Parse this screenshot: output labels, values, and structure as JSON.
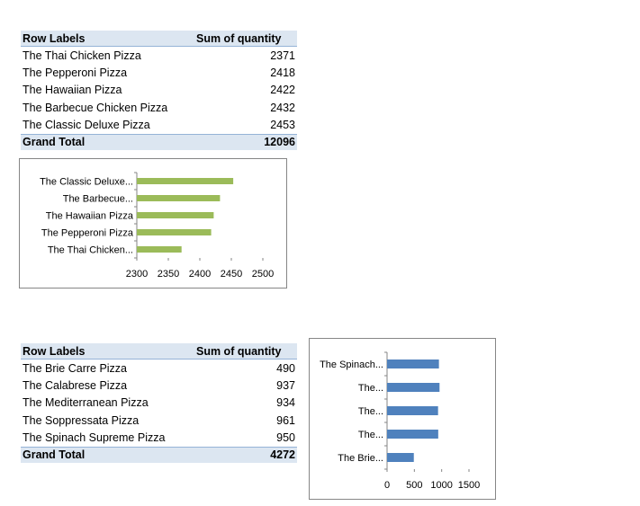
{
  "pivot1": {
    "header": {
      "row_labels": "Row Labels",
      "sum_label": "Sum of quantity"
    },
    "rows": [
      {
        "label": "The Thai Chicken Pizza",
        "value": "2371"
      },
      {
        "label": "The Pepperoni Pizza",
        "value": "2418"
      },
      {
        "label": "The Hawaiian Pizza",
        "value": "2422"
      },
      {
        "label": "The Barbecue Chicken Pizza",
        "value": "2432"
      },
      {
        "label": "The Classic Deluxe Pizza",
        "value": "2453"
      }
    ],
    "total": {
      "label": "Grand Total",
      "value": "12096"
    }
  },
  "pivot2": {
    "header": {
      "row_labels": "Row Labels",
      "sum_label": "Sum of quantity"
    },
    "rows": [
      {
        "label": "The Brie Carre Pizza",
        "value": "490"
      },
      {
        "label": "The Calabrese Pizza",
        "value": "937"
      },
      {
        "label": "The Mediterranean Pizza",
        "value": "934"
      },
      {
        "label": "The Soppressata Pizza",
        "value": "961"
      },
      {
        "label": "The Spinach Supreme Pizza",
        "value": "950"
      }
    ],
    "total": {
      "label": "Grand Total",
      "value": "4272"
    }
  },
  "chart_data": [
    {
      "type": "bar",
      "orientation": "horizontal",
      "color": "#9bbb59",
      "categories": [
        "The Thai Chicken...",
        "The Pepperoni Pizza",
        "The Hawaiian Pizza",
        "The Barbecue...",
        "The Classic Deluxe..."
      ],
      "values": [
        2371,
        2418,
        2422,
        2432,
        2453
      ],
      "xlim": [
        2300,
        2500
      ],
      "ticks": [
        "2300",
        "2350",
        "2400",
        "2450",
        "2500"
      ],
      "tick_values": [
        2300,
        2350,
        2400,
        2450,
        2500
      ]
    },
    {
      "type": "bar",
      "orientation": "horizontal",
      "color": "#4f81bd",
      "categories": [
        "The Brie...",
        "The...",
        "The...",
        "The...",
        "The Spinach..."
      ],
      "values": [
        490,
        937,
        934,
        961,
        950
      ],
      "xlim": [
        0,
        1500
      ],
      "ticks": [
        "0",
        "500",
        "1000",
        "1500"
      ],
      "tick_values": [
        0,
        500,
        1000,
        1500
      ]
    }
  ]
}
